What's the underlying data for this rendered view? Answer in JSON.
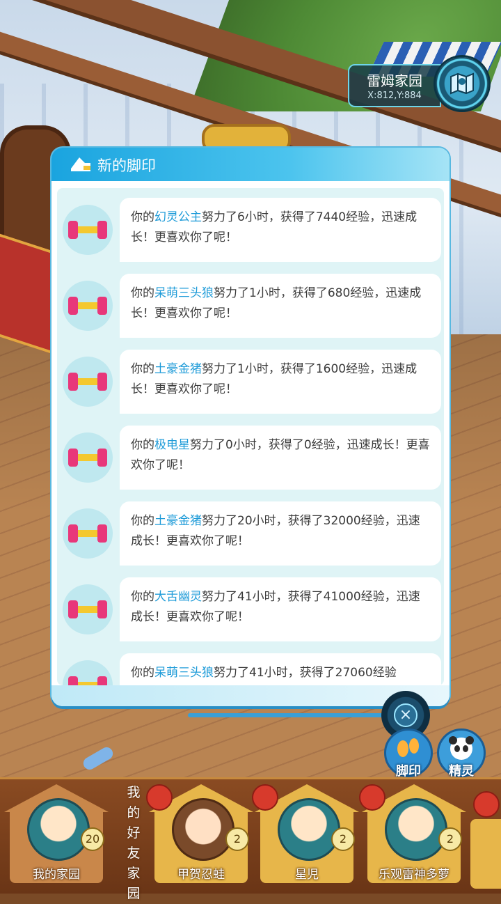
{
  "location": {
    "name": "雷姆家园",
    "coords": "X:812,Y:884"
  },
  "panel": {
    "title": "新的脚印",
    "entries": [
      {
        "prefix": "你的",
        "pet": "幻灵公主",
        "rest": "努力了6小时，获得了7440经验，迅速成长！更喜欢你了呢！"
      },
      {
        "prefix": "你的",
        "pet": "呆萌三头狼",
        "rest": "努力了1小时，获得了680经验，迅速成长！更喜欢你了呢！"
      },
      {
        "prefix": "你的",
        "pet": "土豪金猪",
        "rest": "努力了1小时，获得了1600经验，迅速成长！更喜欢你了呢！"
      },
      {
        "prefix": "你的",
        "pet": "极电星",
        "rest": "努力了0小时，获得了0经验，迅速成长！更喜欢你了呢！"
      },
      {
        "prefix": "你的",
        "pet": "土豪金猪",
        "rest": "努力了20小时，获得了32000经验，迅速成长！更喜欢你了呢！"
      },
      {
        "prefix": "你的",
        "pet": "大舌幽灵",
        "rest": "努力了41小时，获得了41000经验，迅速成长！更喜欢你了呢！"
      },
      {
        "prefix": "你的",
        "pet": "呆萌三头狼",
        "rest": "努力了41小时，获得了27060经验"
      }
    ]
  },
  "side_buttons": {
    "footprint": "脚印",
    "spirit": "精灵"
  },
  "bottom_bar": {
    "my_home": {
      "label": "我的家园",
      "level": "20"
    },
    "friends_label": "我的好友家园",
    "friends": [
      {
        "name": "甲贺忍蛙",
        "level": "2"
      },
      {
        "name": "星児",
        "level": "2"
      },
      {
        "name": "乐观雷神多萝",
        "level": "2"
      }
    ]
  },
  "colors": {
    "accent": "#1aa4df",
    "pet_name": "#1e9bd8",
    "panel_bg": "#dff4f6"
  }
}
